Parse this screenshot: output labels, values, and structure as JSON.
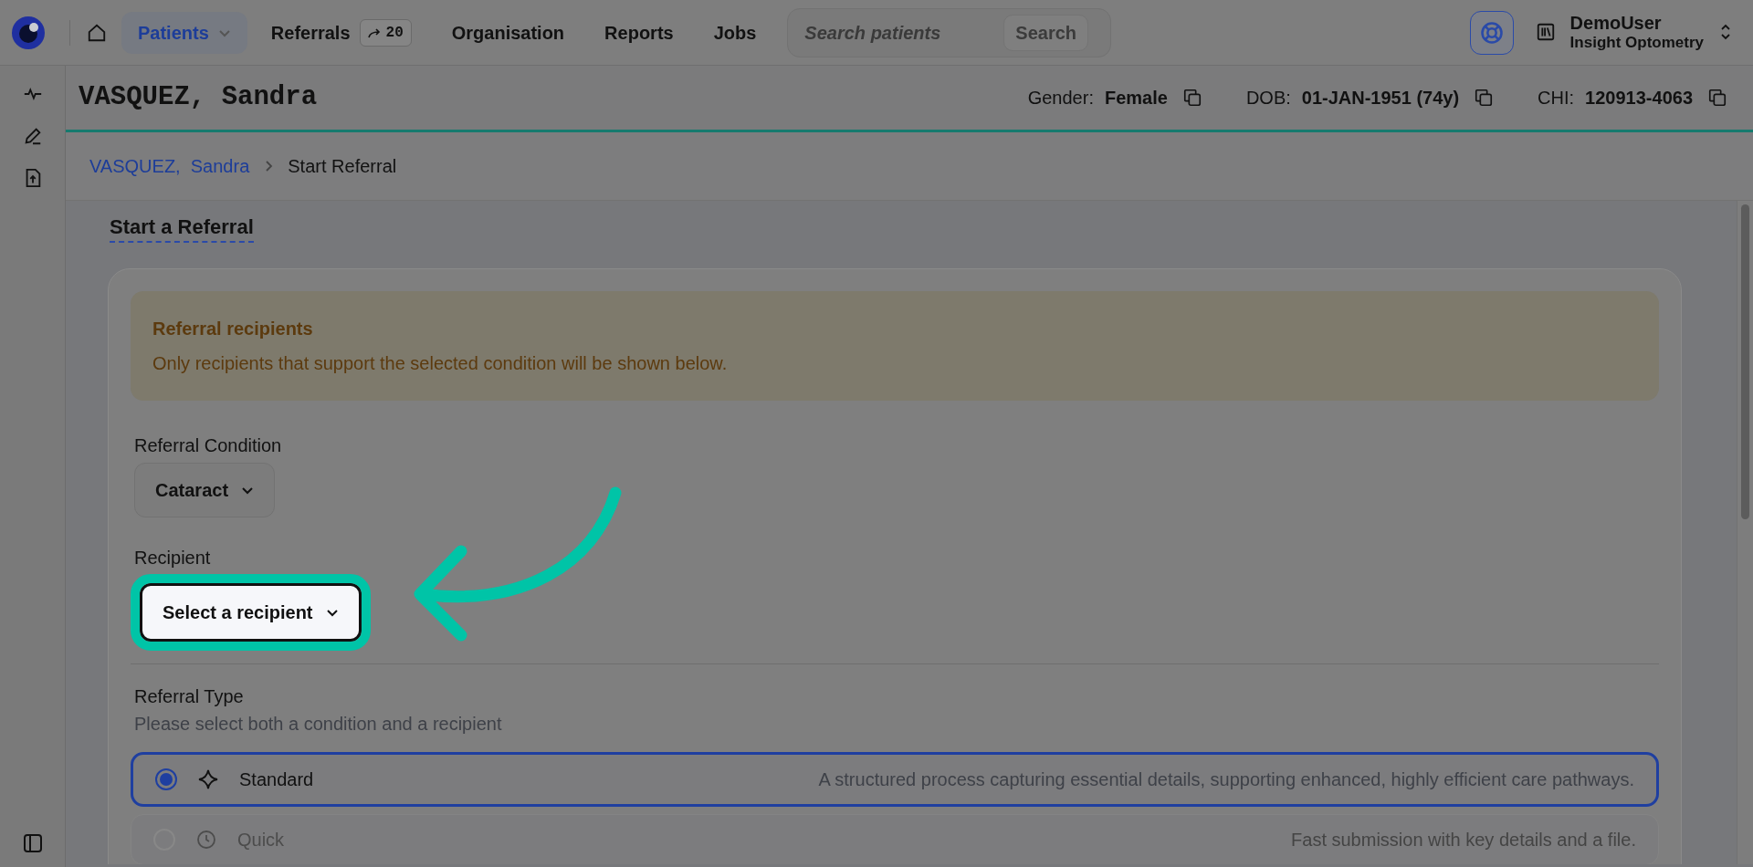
{
  "nav": {
    "items": [
      {
        "label": "Patients",
        "selected": true,
        "dropdown": true
      },
      {
        "label": "Referrals",
        "selected": false,
        "dropdown": false,
        "badge": "20"
      },
      {
        "label": "Organisation",
        "selected": false,
        "dropdown": false
      },
      {
        "label": "Reports",
        "selected": false,
        "dropdown": false
      },
      {
        "label": "Jobs",
        "selected": false,
        "dropdown": false
      }
    ],
    "search": {
      "placeholder": "Search patients",
      "button": "Search"
    },
    "user": {
      "name": "DemoUser",
      "organisation": "Insight Optometry"
    }
  },
  "patient": {
    "name": "VASQUEZ, Sandra",
    "fields": [
      {
        "label": "Gender:",
        "value": "Female"
      },
      {
        "label": "DOB:",
        "value": "01-JAN-1951 (74y)"
      },
      {
        "label": "CHI:",
        "value": "120913-4063"
      }
    ]
  },
  "breadcrumb": [
    {
      "label": "VASQUEZ,  Sandra",
      "link": true
    },
    {
      "label": "Start Referral",
      "link": false
    }
  ],
  "page_title": "Start a Referral",
  "alert": {
    "title": "Referral recipients",
    "text": "Only recipients that support the selected condition will be shown below."
  },
  "condition": {
    "label": "Referral Condition",
    "value": "Cataract"
  },
  "recipient": {
    "label": "Recipient",
    "value": "Select a recipient",
    "highlighted": true
  },
  "referral_type": {
    "label": "Referral Type",
    "hint": "Please select both a condition and a recipient",
    "options": [
      {
        "kind": "sparkle",
        "label": "Standard",
        "description": "A structured process capturing essential details, supporting enhanced, highly efficient care pathways.",
        "selected": true,
        "disabled": false
      },
      {
        "kind": "clock",
        "label": "Quick",
        "description": "Fast submission with key details and a file.",
        "selected": false,
        "disabled": true
      }
    ]
  }
}
